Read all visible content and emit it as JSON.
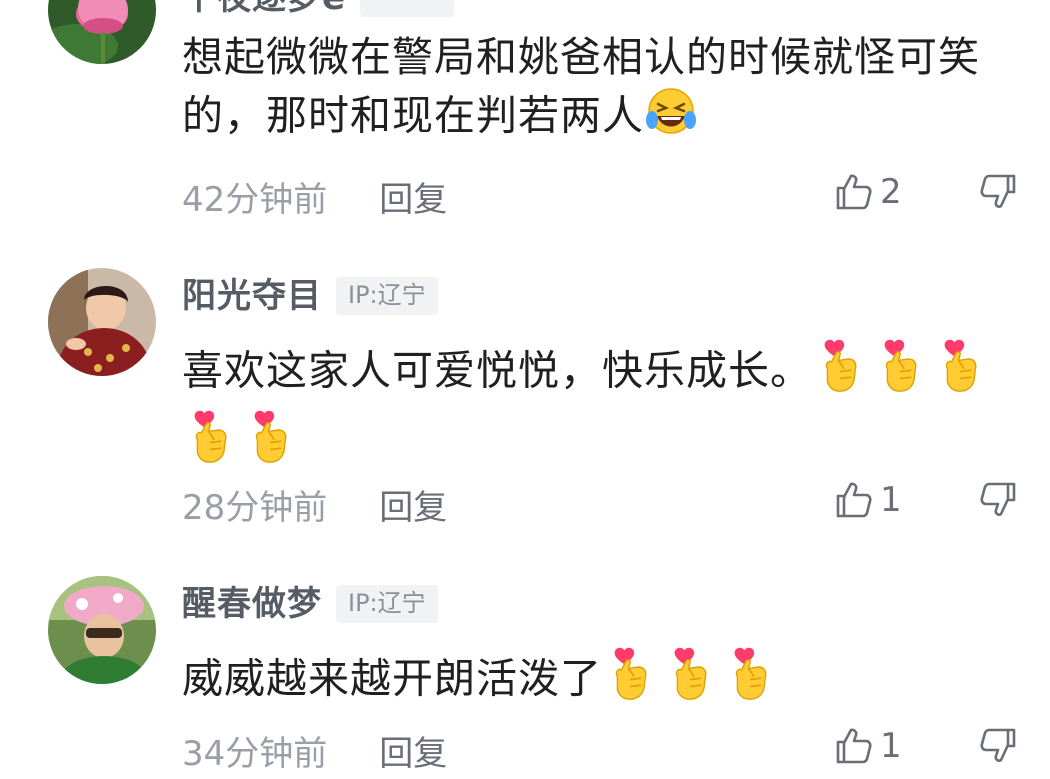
{
  "comments": [
    {
      "user": "千夜逐梦e",
      "ip": "",
      "text": "想起微微在警局和姚爸相认的时候就怪可笑的，那时和现在判若两人",
      "emoji": "rolling-on-floor-laughing",
      "time": "42分钟前",
      "reply_label": "回复",
      "likes": "2"
    },
    {
      "user": "阳光夺目",
      "ip": "IP:辽宁",
      "text": "喜欢这家人可爱悦悦，快乐成长。",
      "emoji": "finger-heart",
      "time": "28分钟前",
      "reply_label": "回复",
      "likes": "1"
    },
    {
      "user": "醒春做梦",
      "ip": "IP:辽宁",
      "text": "威威越来越开朗活泼了",
      "emoji": "finger-heart",
      "time": "34分钟前",
      "reply_label": "回复",
      "likes": "1"
    }
  ],
  "colors": {
    "name": "#555c66",
    "text": "#202020",
    "meta": "#9a9ea6",
    "badge_bg": "#f1f2f4"
  }
}
